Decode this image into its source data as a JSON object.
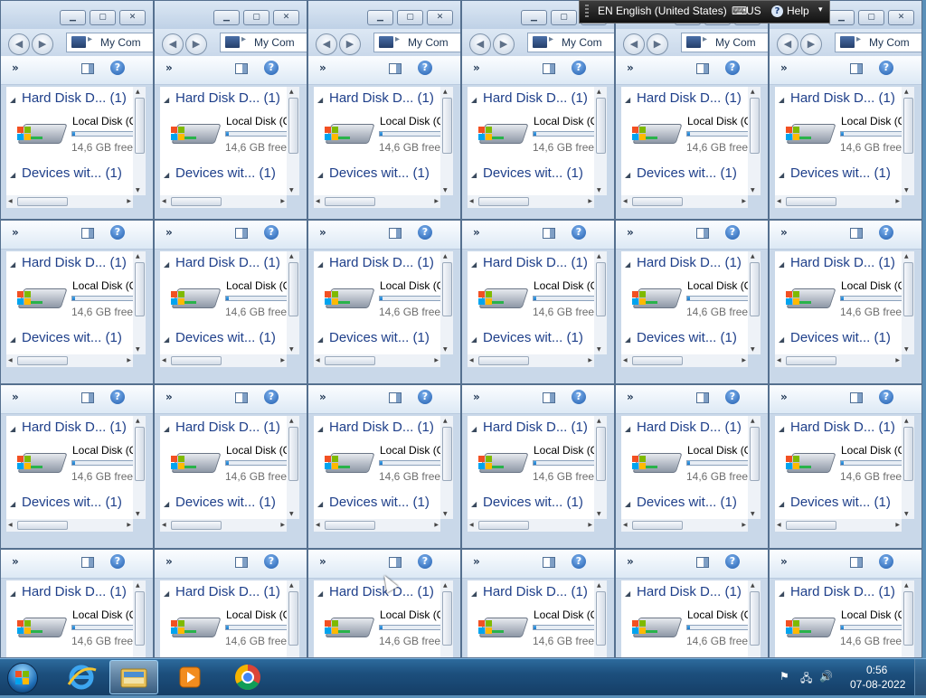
{
  "explorer": {
    "address": "My Com",
    "group_hard_disks": "Hard Disk D... (1)",
    "disk_name": "Local Disk (C",
    "disk_free": "14,6 GB free",
    "disk_used_fraction": 0.05,
    "group_devices": "Devices wit... (1)",
    "more_glyph": "»",
    "help_glyph": "?",
    "window_count": 24,
    "columns": 6
  },
  "language_bar": {
    "language": "EN English (United States)",
    "keyboard": "US",
    "help": "Help"
  },
  "taskbar": {
    "clock_time": "0:56",
    "clock_date": "07-08-2022",
    "items": [
      {
        "name": "internet-explorer",
        "icon": "ie-icon"
      },
      {
        "name": "windows-explorer",
        "icon": "folder-icon",
        "active": true
      },
      {
        "name": "media-player",
        "icon": "media-player-icon"
      },
      {
        "name": "google-chrome",
        "icon": "chrome-icon"
      }
    ]
  },
  "colors": {
    "accent_link": "#1e3f8a",
    "taskbar": "#1c4f7d",
    "window_chrome": "#c9d8e9"
  }
}
